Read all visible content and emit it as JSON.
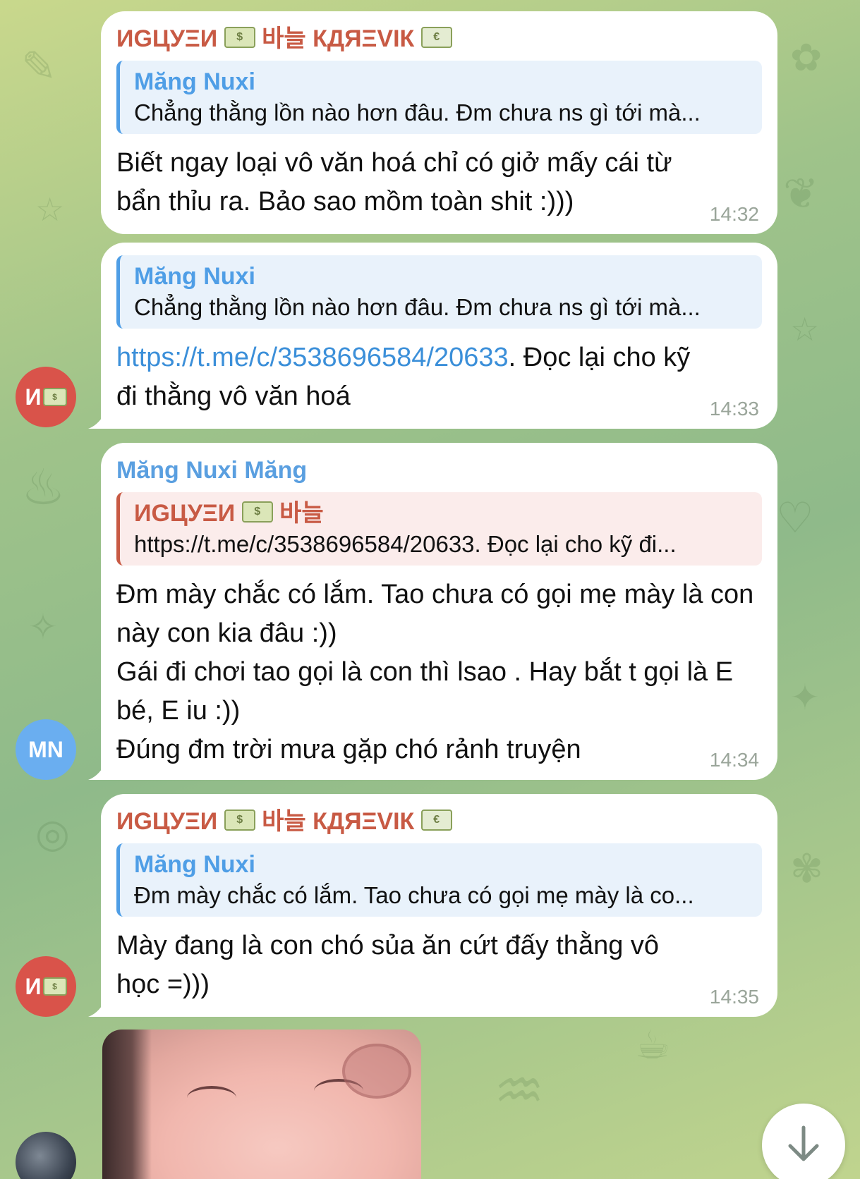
{
  "messages": [
    {
      "sender": "ИGЦУΞИ",
      "sender_tail": "바늘 КДЯΞVIК",
      "reply_to": {
        "name": "Măng Nuxi",
        "text": "Chẳng thằng lồn nào hơn đâu. Đm chưa ns gì tới mà..."
      },
      "text": "Biết ngay loại vô văn hoá chỉ có giở mấy cái từ bẩn thỉu ra. Bảo sao mồm toàn shit :)))",
      "time": "14:32"
    },
    {
      "reply_to": {
        "name": "Măng Nuxi",
        "text": "Chẳng thằng lồn nào hơn đâu. Đm chưa ns gì tới mà..."
      },
      "link": "https://t.me/c/3538696584/20633",
      "text": ". Đọc lại cho kỹ đi thằng vô văn hoá",
      "time": "14:33",
      "avatar_text": "И"
    },
    {
      "sender": "Măng Nuxi Măng",
      "reply_to": {
        "name": "ИGЦУΞИ",
        "name_tail": "바늘",
        "text": "https://t.me/c/3538696584/20633. Đọc lại cho kỹ đi..."
      },
      "lines": [
        "Đm mày chắc có lắm. Tao chưa có gọi mẹ mày là con này con kia đâu :))",
        "Gái đi chơi tao gọi là con thì lsao  . Hay bắt t gọi là E bé, E iu :))",
        "Đúng đm trời mưa gặp chó rảnh truyện"
      ],
      "time": "14:34",
      "avatar_text": "MN"
    },
    {
      "sender": "ИGЦУΞИ",
      "sender_tail": "바늘 КДЯΞVIК",
      "reply_to": {
        "name": "Măng Nuxi",
        "text": "Đm mày chắc có lắm. Tao chưa có gọi mẹ mày là co..."
      },
      "text": "Mày đang là con chó sủa ăn cứt đấy thằng vô học =)))",
      "time": "14:35",
      "avatar_text": "И"
    }
  ],
  "colors": {
    "accent_blue": "#4f9ee6",
    "accent_red": "#c85a44",
    "link": "#3b8fd9"
  },
  "icons": {
    "scroll_down": "arrow-down-icon"
  }
}
